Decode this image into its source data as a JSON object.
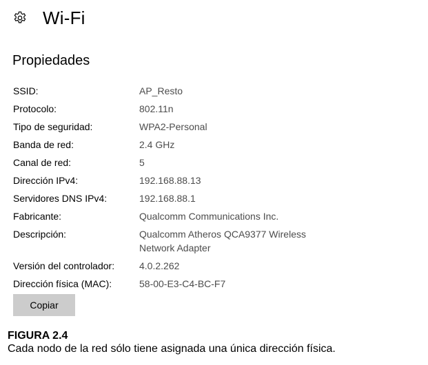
{
  "header": {
    "title": "Wi-Fi",
    "icon": "gear-icon"
  },
  "section": {
    "title": "Propiedades"
  },
  "properties": [
    {
      "label": "SSID:",
      "value": "AP_Resto"
    },
    {
      "label": "Protocolo:",
      "value": "802.11n"
    },
    {
      "label": "Tipo de seguridad:",
      "value": "WPA2-Personal"
    },
    {
      "label": "Banda de red:",
      "value": "2.4 GHz"
    },
    {
      "label": "Canal de red:",
      "value": "5"
    },
    {
      "label": "Dirección IPv4:",
      "value": "192.168.88.13"
    },
    {
      "label": "Servidores DNS IPv4:",
      "value": "192.168.88.1"
    },
    {
      "label": "Fabricante:",
      "value": "Qualcomm Communications Inc."
    },
    {
      "label": "Descripción:",
      "value_line1": "Qualcomm Atheros QCA9377 Wireless",
      "value_line2": "Network Adapter"
    },
    {
      "label": "Versión del controlador:",
      "value": "4.0.2.262"
    },
    {
      "label": "Dirección física (MAC):",
      "value": "58-00-E3-C4-BC-F7"
    }
  ],
  "actions": {
    "copy_label": "Copiar"
  },
  "caption": {
    "figure_label": "FIGURA 2.4",
    "text": "Cada nodo de la red sólo tiene asignada una única dirección física."
  },
  "colors": {
    "label_text": "#000000",
    "value_text": "#4c4c4c",
    "button_bg": "#cccccc"
  }
}
